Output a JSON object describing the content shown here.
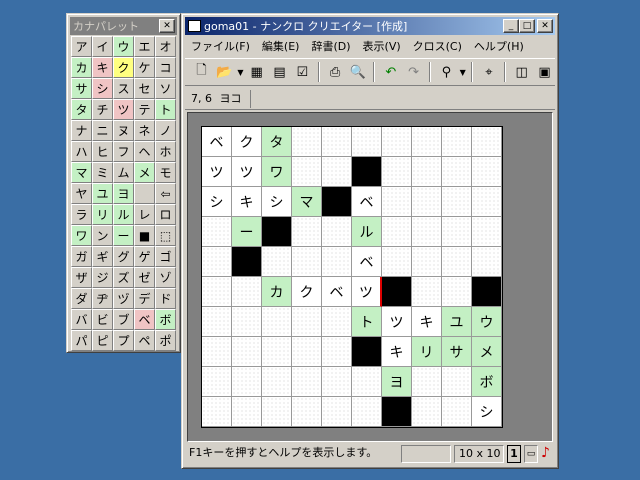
{
  "palette": {
    "title": "カナパレット",
    "keys": [
      {
        "ch": "ア",
        "s": ""
      },
      {
        "ch": "イ",
        "s": ""
      },
      {
        "ch": "ウ",
        "s": "green"
      },
      {
        "ch": "エ",
        "s": ""
      },
      {
        "ch": "オ",
        "s": ""
      },
      {
        "ch": "カ",
        "s": "green"
      },
      {
        "ch": "キ",
        "s": "pink"
      },
      {
        "ch": "ク",
        "s": "yellow"
      },
      {
        "ch": "ケ",
        "s": ""
      },
      {
        "ch": "コ",
        "s": ""
      },
      {
        "ch": "サ",
        "s": "green"
      },
      {
        "ch": "シ",
        "s": "pink"
      },
      {
        "ch": "ス",
        "s": ""
      },
      {
        "ch": "セ",
        "s": ""
      },
      {
        "ch": "ソ",
        "s": ""
      },
      {
        "ch": "タ",
        "s": "green"
      },
      {
        "ch": "チ",
        "s": ""
      },
      {
        "ch": "ツ",
        "s": "pink"
      },
      {
        "ch": "テ",
        "s": ""
      },
      {
        "ch": "ト",
        "s": "green"
      },
      {
        "ch": "ナ",
        "s": ""
      },
      {
        "ch": "ニ",
        "s": ""
      },
      {
        "ch": "ヌ",
        "s": ""
      },
      {
        "ch": "ネ",
        "s": ""
      },
      {
        "ch": "ノ",
        "s": ""
      },
      {
        "ch": "ハ",
        "s": ""
      },
      {
        "ch": "ヒ",
        "s": ""
      },
      {
        "ch": "フ",
        "s": ""
      },
      {
        "ch": "ヘ",
        "s": ""
      },
      {
        "ch": "ホ",
        "s": ""
      },
      {
        "ch": "マ",
        "s": "green"
      },
      {
        "ch": "ミ",
        "s": ""
      },
      {
        "ch": "ム",
        "s": ""
      },
      {
        "ch": "メ",
        "s": "green"
      },
      {
        "ch": "モ",
        "s": ""
      },
      {
        "ch": "ヤ",
        "s": ""
      },
      {
        "ch": "ユ",
        "s": "green"
      },
      {
        "ch": "ヨ",
        "s": "green"
      },
      {
        "ch": "",
        "s": ""
      },
      {
        "ch": "⇦",
        "s": ""
      },
      {
        "ch": "ラ",
        "s": ""
      },
      {
        "ch": "リ",
        "s": "green"
      },
      {
        "ch": "ル",
        "s": "green"
      },
      {
        "ch": "レ",
        "s": ""
      },
      {
        "ch": "ロ",
        "s": ""
      },
      {
        "ch": "ワ",
        "s": "green"
      },
      {
        "ch": "ン",
        "s": ""
      },
      {
        "ch": "ー",
        "s": "green"
      },
      {
        "ch": "■",
        "s": ""
      },
      {
        "ch": "⬚",
        "s": ""
      },
      {
        "ch": "ガ",
        "s": ""
      },
      {
        "ch": "ギ",
        "s": ""
      },
      {
        "ch": "グ",
        "s": ""
      },
      {
        "ch": "ゲ",
        "s": ""
      },
      {
        "ch": "ゴ",
        "s": ""
      },
      {
        "ch": "ザ",
        "s": ""
      },
      {
        "ch": "ジ",
        "s": ""
      },
      {
        "ch": "ズ",
        "s": ""
      },
      {
        "ch": "ゼ",
        "s": ""
      },
      {
        "ch": "ゾ",
        "s": ""
      },
      {
        "ch": "ダ",
        "s": ""
      },
      {
        "ch": "ヂ",
        "s": ""
      },
      {
        "ch": "ヅ",
        "s": ""
      },
      {
        "ch": "デ",
        "s": ""
      },
      {
        "ch": "ド",
        "s": ""
      },
      {
        "ch": "バ",
        "s": ""
      },
      {
        "ch": "ビ",
        "s": ""
      },
      {
        "ch": "ブ",
        "s": ""
      },
      {
        "ch": "ベ",
        "s": "pink"
      },
      {
        "ch": "ボ",
        "s": "green"
      },
      {
        "ch": "パ",
        "s": ""
      },
      {
        "ch": "ピ",
        "s": ""
      },
      {
        "ch": "プ",
        "s": ""
      },
      {
        "ch": "ペ",
        "s": ""
      },
      {
        "ch": "ポ",
        "s": ""
      }
    ]
  },
  "window": {
    "title": "goma01 - ナンクロ クリエイター [作成]",
    "menus": [
      "ファイル(F)",
      "編集(E)",
      "辞書(D)",
      "表示(V)",
      "クロス(C)",
      "ヘルプ(H)"
    ],
    "cell_position": "7, 6",
    "direction": "ヨコ",
    "status_help": "F1キーを押すとヘルプを表示します。",
    "grid_size": "10 x 10",
    "status_num": "1"
  },
  "grid": [
    [
      "ベ",
      "ク",
      "タ",
      "",
      "",
      "",
      "",
      "",
      "",
      ""
    ],
    [
      "ツ",
      "ツ",
      "ワ",
      "",
      "",
      "#",
      "",
      "",
      "",
      ""
    ],
    [
      "シ",
      "キ",
      "シ",
      "マ",
      "#",
      "ベ",
      "",
      "",
      "",
      ""
    ],
    [
      "",
      "ー",
      "#",
      "",
      "",
      "ル",
      "",
      "",
      "",
      ""
    ],
    [
      "",
      "#",
      "",
      "",
      "",
      "ベ",
      "",
      "",
      "",
      ""
    ],
    [
      "",
      "",
      "カ",
      "ク",
      "ベ",
      "ツ",
      "#",
      "",
      "",
      "#"
    ],
    [
      "",
      "",
      "",
      "",
      "",
      "ト",
      "ツ",
      "キ",
      "ユ",
      "ウ"
    ],
    [
      "",
      "",
      "",
      "",
      "",
      "#",
      "キ",
      "リ",
      "サ",
      "メ"
    ],
    [
      "",
      "",
      "",
      "",
      "",
      "",
      "ヨ",
      "",
      "",
      "ボ"
    ],
    [
      "",
      "",
      "",
      "",
      "",
      "",
      "#",
      "",
      "",
      "シ"
    ]
  ],
  "green_cells": [
    "0,2",
    "1,2",
    "2,3",
    "3,1",
    "3,5",
    "5,2",
    "6,5",
    "6,8",
    "6,9",
    "7,7",
    "7,8",
    "7,9",
    "8,6",
    "8,9"
  ],
  "colors": {
    "accent": "#0a246a",
    "green": "#c4f0c4",
    "pink": "#f0c4c4",
    "yellow": "#ffff80",
    "desktop": "#3a6ea5"
  }
}
